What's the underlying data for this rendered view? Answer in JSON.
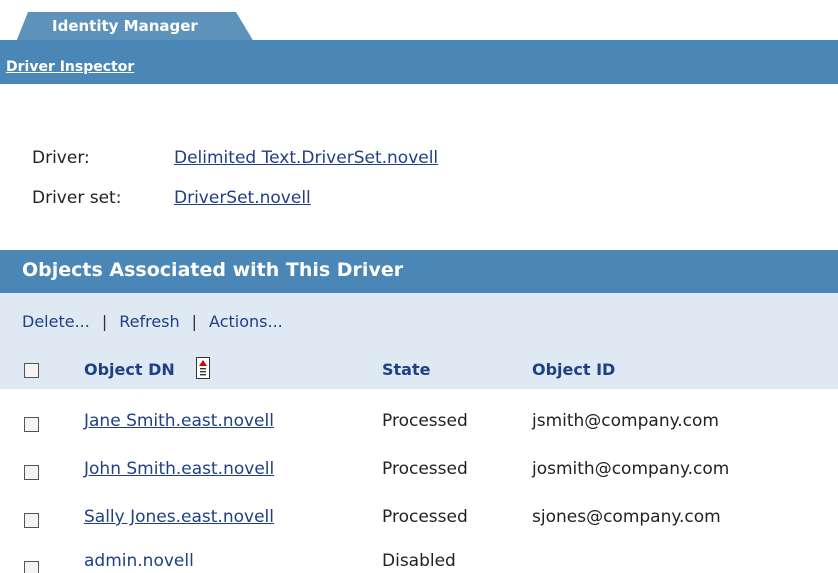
{
  "tab": {
    "label": "Identity Manager"
  },
  "subnav": {
    "link": "Driver Inspector"
  },
  "driver_info": {
    "driver_label": "Driver:",
    "driver_value": "Delimited Text.DriverSet.novell",
    "driver_set_label": "Driver set:",
    "driver_set_value": "DriverSet.novell"
  },
  "panel": {
    "title": "Objects Associated with This Driver",
    "toolbar": {
      "delete": "Delete...",
      "refresh": "Refresh",
      "actions": "Actions...",
      "separator": "|"
    },
    "columns": {
      "object_dn": "Object DN",
      "state": "State",
      "object_id": "Object ID"
    },
    "rows": [
      {
        "dn": "Jane Smith.east.novell",
        "state": "Processed",
        "id": "jsmith@company.com"
      },
      {
        "dn": "John Smith.east.novell",
        "state": "Processed",
        "id": "josmith@company.com"
      },
      {
        "dn": "Sally Jones.east.novell",
        "state": "Processed",
        "id": "sjones@company.com"
      },
      {
        "dn": "admin.novell",
        "state": "Disabled",
        "id": ""
      }
    ]
  },
  "colors": {
    "header_blue": "#4a86b6",
    "panel_light": "#dfe9f3",
    "link_blue": "#1f3f86",
    "sort_arrow_red": "#cc0000"
  },
  "icons": {
    "sort": "sort-descending-icon"
  }
}
